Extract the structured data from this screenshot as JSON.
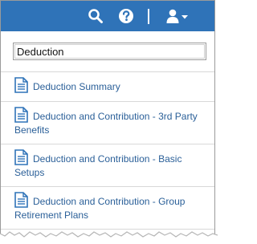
{
  "header": {
    "icons": [
      "search-icon",
      "help-icon",
      "user-icon",
      "caret-down-icon"
    ],
    "background_color": "#2f73b8"
  },
  "search": {
    "value": "Deduction",
    "placeholder": ""
  },
  "results": [
    {
      "label": "Deduction Summary",
      "icon": "document-icon"
    },
    {
      "label": "Deduction and Contribution - 3rd Party Benefits",
      "icon": "document-icon"
    },
    {
      "label": "Deduction and Contribution - Basic Setups",
      "icon": "document-icon"
    },
    {
      "label": "Deduction and Contribution - Group Retirement Plans",
      "icon": "document-icon"
    }
  ],
  "colors": {
    "link": "#2a5f98",
    "icon": "#2f73b8"
  }
}
